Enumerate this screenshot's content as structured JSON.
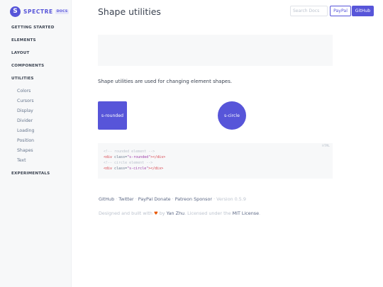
{
  "brand": {
    "logo_letter": "S",
    "name": "SPECTRE",
    "badge": "DOCS"
  },
  "sidebar": {
    "groups": [
      {
        "label": "GETTING STARTED"
      },
      {
        "label": "ELEMENTS"
      },
      {
        "label": "LAYOUT"
      },
      {
        "label": "COMPONENTS"
      },
      {
        "label": "UTILITIES"
      },
      {
        "label": "EXPERIMENTALS"
      }
    ],
    "utilities_items": [
      "Colors",
      "Cursors",
      "Display",
      "Divider",
      "Loading",
      "Position",
      "Shapes",
      "Text"
    ]
  },
  "header": {
    "title": "Shape utilities",
    "search_placeholder": "Search Docs",
    "paypal_label": "PayPal",
    "github_label": "GitHub"
  },
  "main": {
    "description": "Shape utilities are used for changing element shapes.",
    "demo_rounded_label": "s-rounded",
    "demo_circle_label": "s-circle",
    "code": {
      "lang": "HTML",
      "comment1": "<!-- rounded element -->",
      "tag_open": "<div",
      "attr": " class=",
      "value1": "\"s-rounded\"",
      "tag_close": "></div>",
      "comment2": "<!-- circle element -->",
      "value2": "\"s-circle\""
    }
  },
  "footer": {
    "links": [
      "GitHub",
      "Twitter",
      "PayPal Donate",
      "Patreon Sponsor"
    ],
    "separator": " · ",
    "version": "Version 0.5.9",
    "credit_prefix": "Designed and built with ",
    "heart": "♥",
    "credit_by": " by ",
    "author": "Yan Zhu",
    "credit_mid": ". Licensed under the ",
    "license": "MIT License",
    "credit_end": "."
  },
  "colors": {
    "primary": "#5755d9",
    "body": "#3b4351",
    "muted": "#bcc3ce",
    "secondary_text": "#66758c",
    "panel_bg": "#f7f8f9"
  }
}
